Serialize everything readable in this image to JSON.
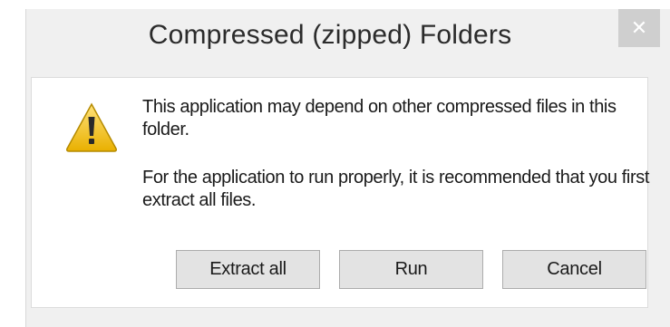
{
  "dialog": {
    "title": "Compressed (zipped) Folders",
    "close_label": "✕",
    "message_line_1": "This application may depend on other compressed files in this folder.",
    "message_line_2": "For the application to run properly, it is recommended that you first extract all files.",
    "icon": "warning-icon",
    "buttons": {
      "extract_all": "Extract all",
      "run": "Run",
      "cancel": "Cancel"
    }
  },
  "colors": {
    "window_bg": "#f0f0f0",
    "content_bg": "#ffffff",
    "close_bg": "#cfcfcf",
    "button_bg": "#e3e3e3",
    "warning_yellow": "#f2c200"
  }
}
